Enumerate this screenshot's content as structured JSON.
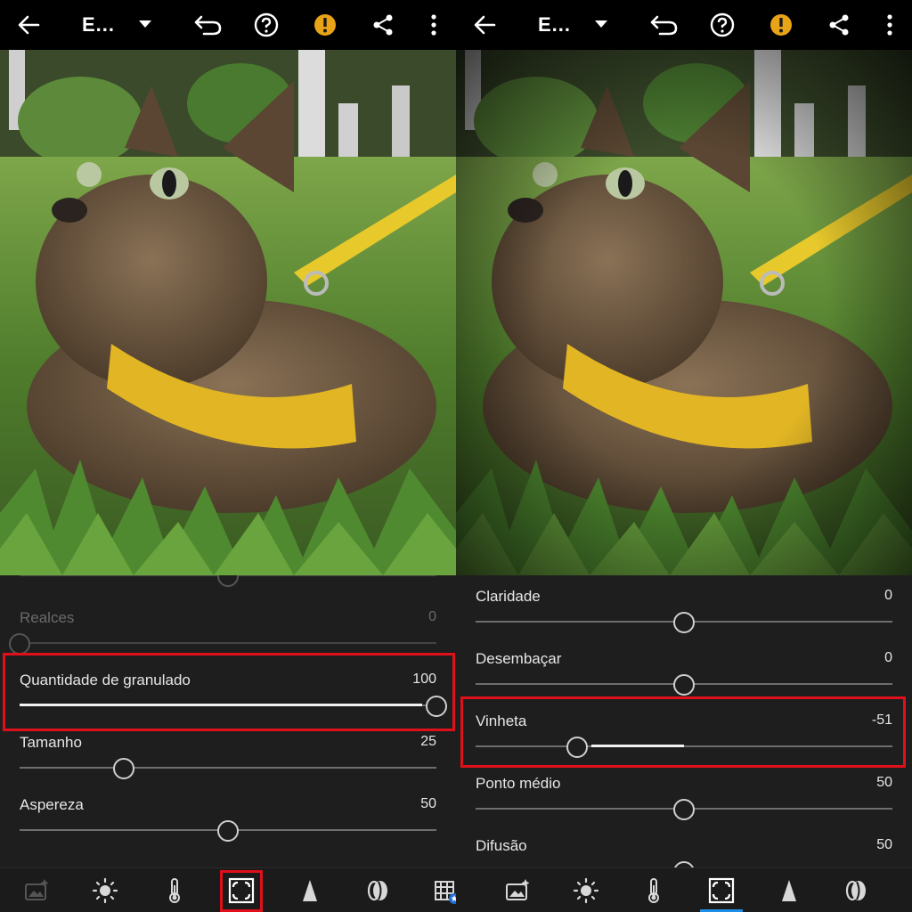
{
  "left": {
    "title": "E...",
    "sliders": [
      {
        "label": "",
        "value": "",
        "pos": 0.5
      },
      {
        "label": "Realces",
        "value": "0",
        "pos": 0.0
      },
      {
        "label": "Quantidade de granulado",
        "value": "100",
        "pos": 1.0
      },
      {
        "label": "Tamanho",
        "value": "25",
        "pos": 0.25
      },
      {
        "label": "Aspereza",
        "value": "50",
        "pos": 0.5
      }
    ],
    "tools": [
      "auto-photo-icon",
      "light-icon",
      "color-temperature-icon",
      "effects-icon",
      "detail-icon",
      "optics-icon",
      "geometry-icon"
    ],
    "selected_tool": "effects-icon"
  },
  "right": {
    "title": "E...",
    "sliders": [
      {
        "label": "Claridade",
        "value": "0",
        "pos": 0.5
      },
      {
        "label": "Desembaçar",
        "value": "0",
        "pos": 0.5
      },
      {
        "label": "Vinheta",
        "value": "-51",
        "pos": 0.245
      },
      {
        "label": "Ponto médio",
        "value": "50",
        "pos": 0.5
      },
      {
        "label": "Difusão",
        "value": "50",
        "pos": 0.5
      }
    ],
    "tools": [
      "auto-photo-icon",
      "light-icon",
      "color-temperature-icon",
      "effects-icon",
      "detail-icon",
      "optics-icon"
    ],
    "selected_tool": "effects-icon"
  },
  "colors": {
    "highlight": "#e0101a",
    "warning": "#e8a317",
    "selected_tab": "#1f8ee6"
  }
}
